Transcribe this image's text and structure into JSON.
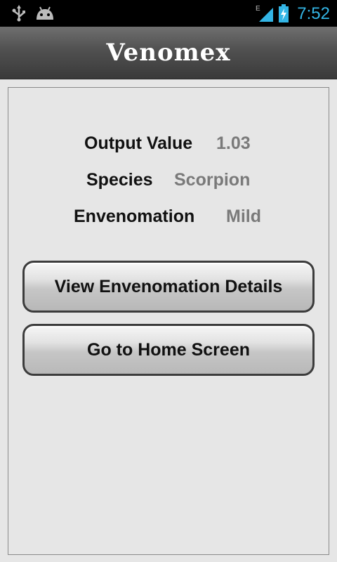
{
  "status_bar": {
    "time": "7:52",
    "network_type": "E",
    "icons": [
      "usb-icon",
      "android-debug-icon",
      "signal-icon",
      "battery-charging-icon"
    ],
    "clock_color": "#33b5e5"
  },
  "app": {
    "title": "Venomex"
  },
  "results": [
    {
      "label": "Output Value",
      "value": "1.03"
    },
    {
      "label": "Species",
      "value": "Scorpion"
    },
    {
      "label": "Envenomation",
      "value": "Mild"
    }
  ],
  "buttons": {
    "details_label": "View Envenomation Details",
    "home_label": "Go to Home Screen"
  }
}
